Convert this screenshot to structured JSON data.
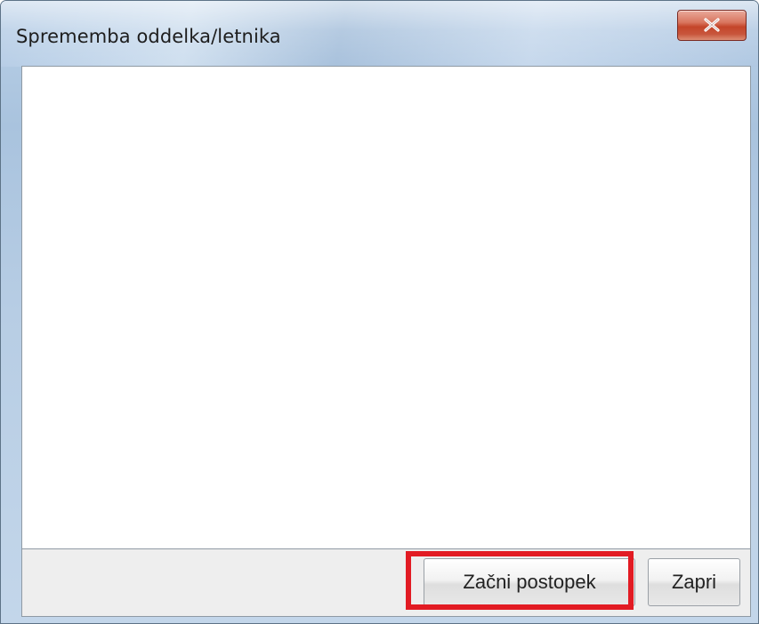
{
  "window": {
    "title": "Sprememba oddelka/letnika",
    "close_icon": "close-x-icon"
  },
  "buttons": {
    "start_label": "Začni postopek",
    "close_label": "Zapri"
  },
  "colors": {
    "highlight": "#e21b23",
    "close_button": "#c4452a"
  }
}
